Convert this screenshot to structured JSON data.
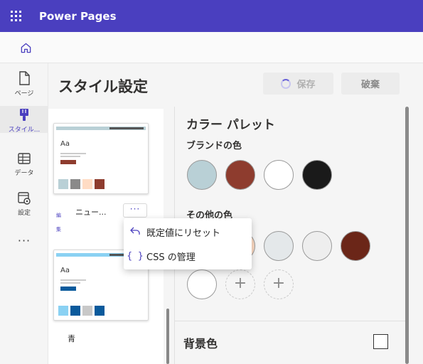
{
  "app": {
    "name": "Power Pages"
  },
  "nav": {
    "items": [
      {
        "label": "ページ",
        "icon": "page-icon"
      },
      {
        "label": "スタイル...",
        "icon": "paintbrush-icon"
      },
      {
        "label": "データ",
        "icon": "table-icon"
      },
      {
        "label": "設定",
        "icon": "settings-icon"
      }
    ],
    "more": "···",
    "active_color": "#4a3fbf"
  },
  "header": {
    "title": "スタイル設定",
    "save": "保存",
    "discard": "破棄"
  },
  "themes": [
    {
      "name": "ニュー...",
      "edit_label": "編集",
      "colors": [
        "#b9d0d6",
        "#8a8a8a",
        "#ffdcc4",
        "#8e3c2e"
      ],
      "bar": "#b9d0d6",
      "accent": "#8e3c2e"
    },
    {
      "name": "青",
      "colors": [
        "#8ad1f3",
        "#0a5a9c",
        "#c8c8c8",
        "#0a5a9c"
      ],
      "bar": "#8ad1f3",
      "accent": "#0a5a9c"
    }
  ],
  "theme_more": "···",
  "menu": {
    "items": [
      {
        "label": "既定値にリセット",
        "icon": "undo-icon"
      },
      {
        "label": "CSS の管理",
        "icon": "braces-icon"
      }
    ]
  },
  "palette": {
    "title": "カラー パレット",
    "brand_title": "ブランドの色",
    "brand_colors": [
      "#b9d0d6",
      "#8e3c2e",
      "#ffffff",
      "#1a1a1a"
    ],
    "other_title": "その他の色",
    "other_colors": [
      "#ffdcc4",
      "#e4e8ea",
      "#eeeeee",
      "#6b2618",
      "#ffffff"
    ],
    "add_label": "+"
  },
  "background": {
    "title": "背景色",
    "value": "#ffffff"
  }
}
